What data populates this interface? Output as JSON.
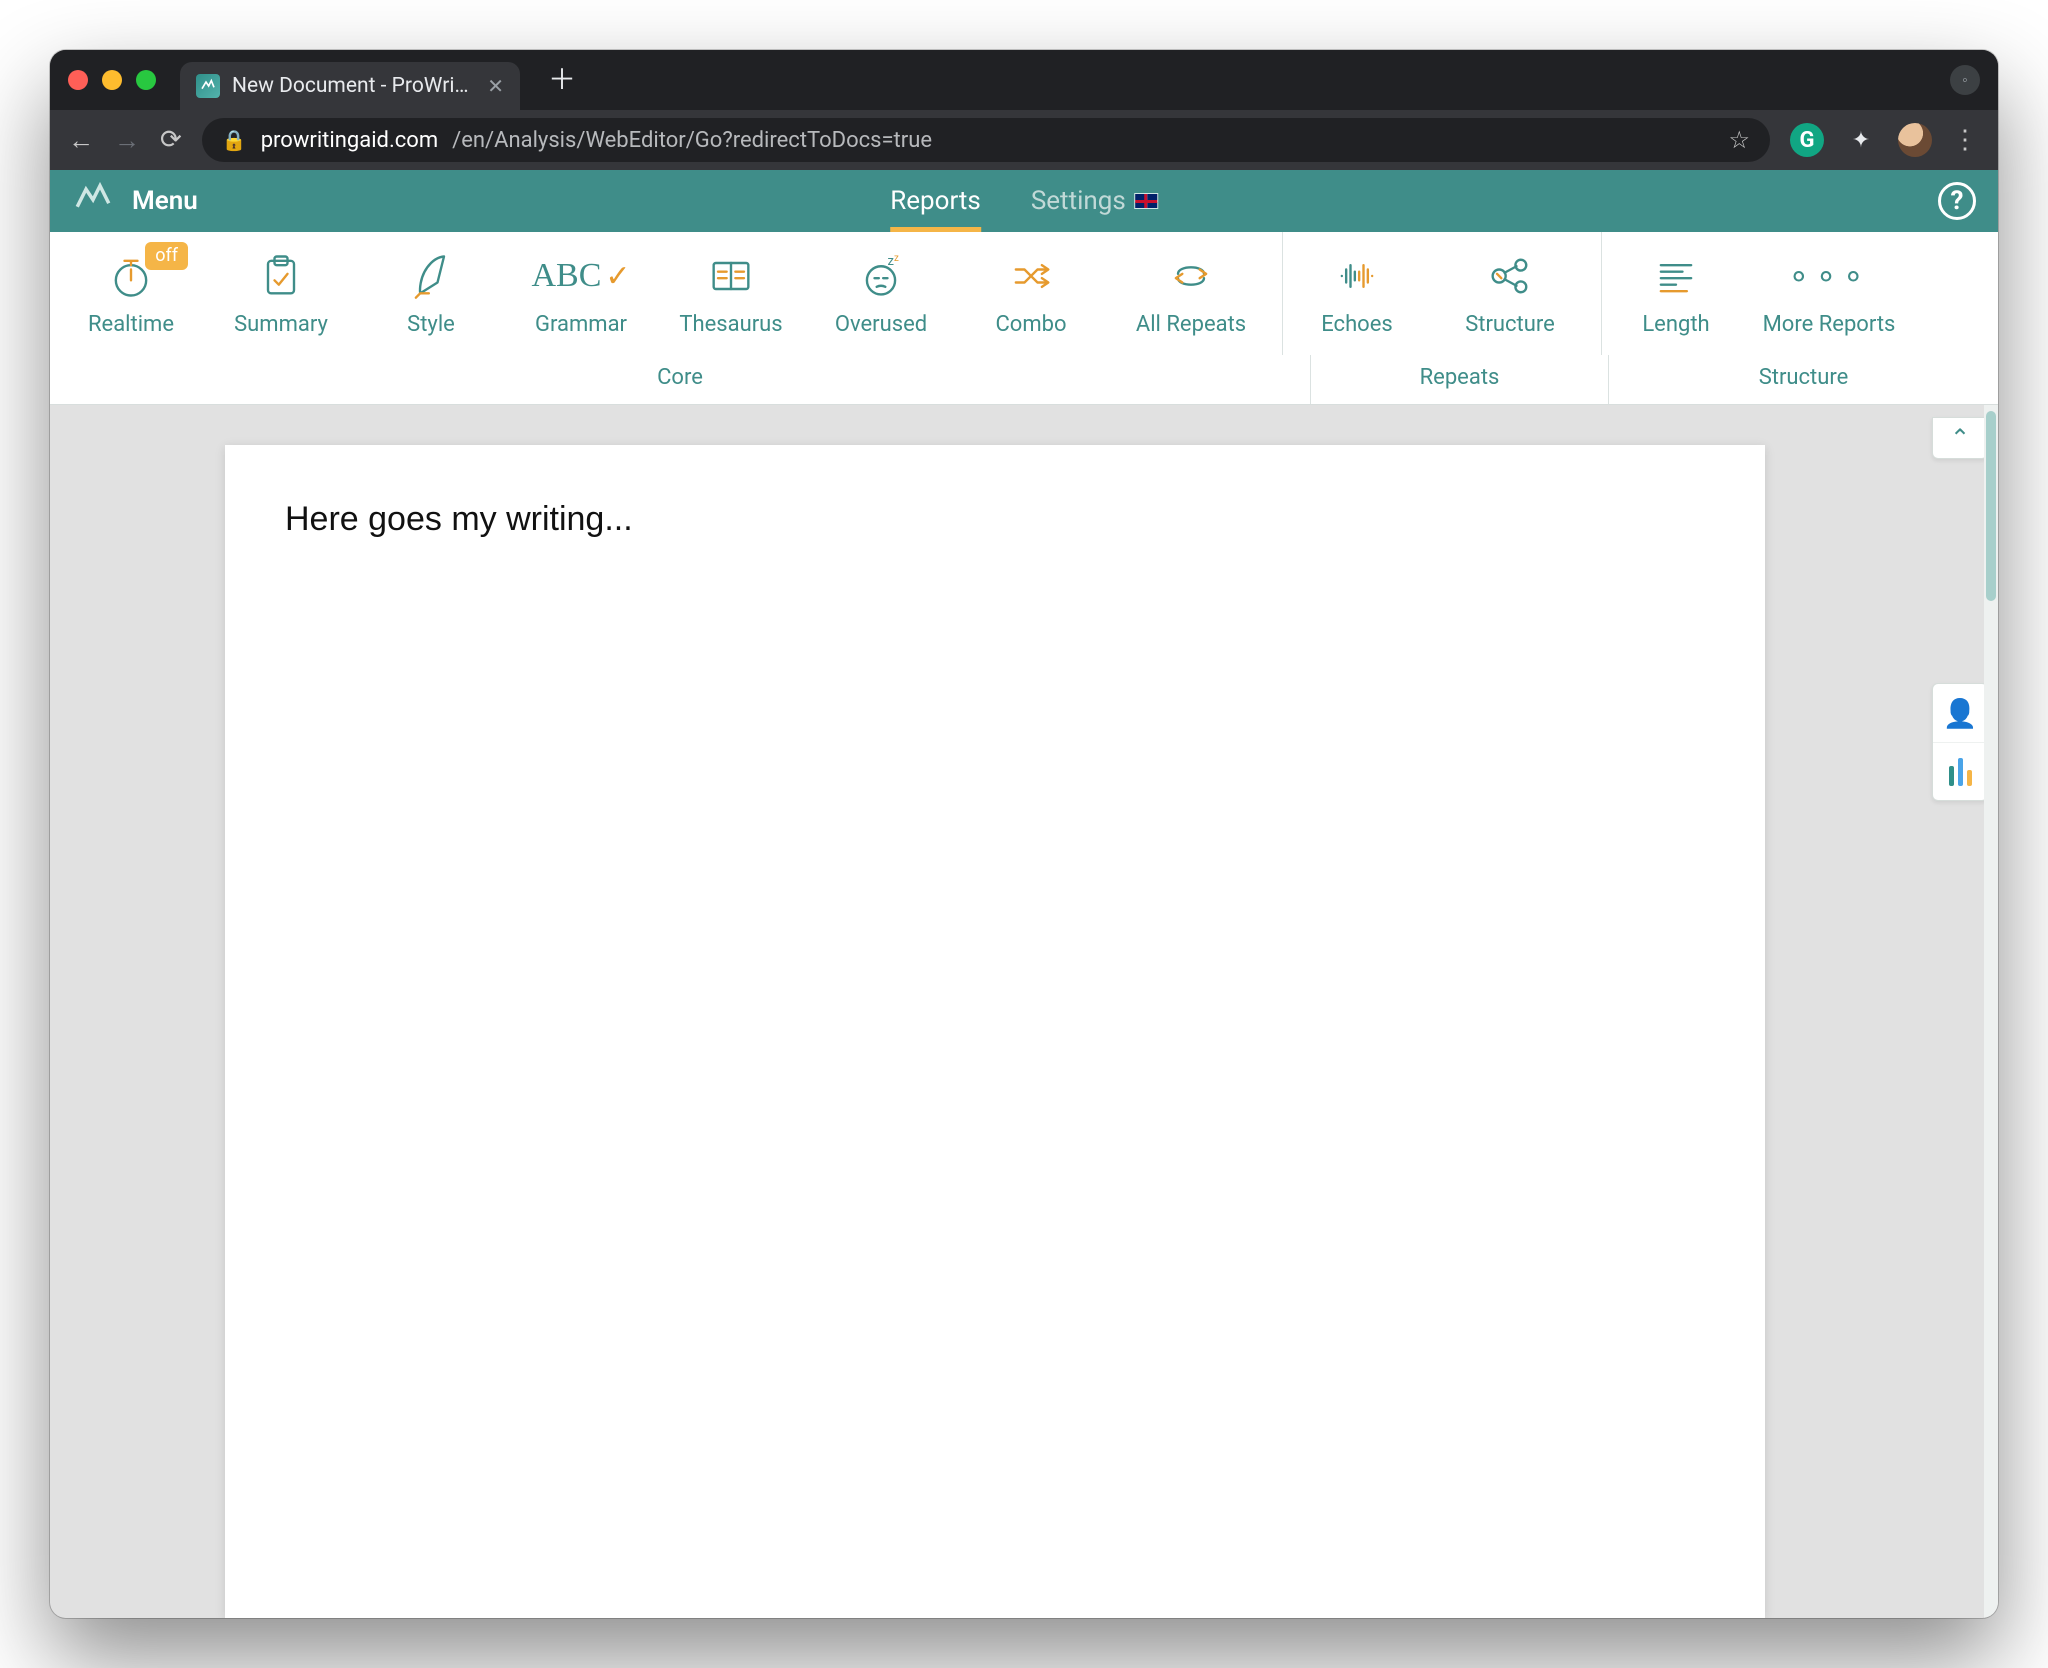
{
  "browser": {
    "tab_title": "New Document - ProWritingAid",
    "url_domain": "prowritingaid.com",
    "url_path": "/en/Analysis/WebEditor/Go?redirectToDocs=true"
  },
  "appbar": {
    "menu": "Menu",
    "tabs": {
      "reports": "Reports",
      "settings": "Settings"
    },
    "help": "?"
  },
  "toolbar": {
    "realtime": {
      "label": "Realtime",
      "badge": "off"
    },
    "summary": {
      "label": "Summary"
    },
    "style": {
      "label": "Style"
    },
    "grammar": {
      "label": "Grammar"
    },
    "thesaurus": {
      "label": "Thesaurus"
    },
    "overused": {
      "label": "Overused"
    },
    "combo": {
      "label": "Combo"
    },
    "allrepeats": {
      "label": "All Repeats"
    },
    "echoes": {
      "label": "Echoes"
    },
    "structure": {
      "label": "Structure"
    },
    "length": {
      "label": "Length"
    },
    "more": {
      "label": "More Reports"
    }
  },
  "toolbar_groups": {
    "core": "Core",
    "repeats": "Repeats",
    "structure": "Structure"
  },
  "document": {
    "text": "Here goes my writing..."
  }
}
